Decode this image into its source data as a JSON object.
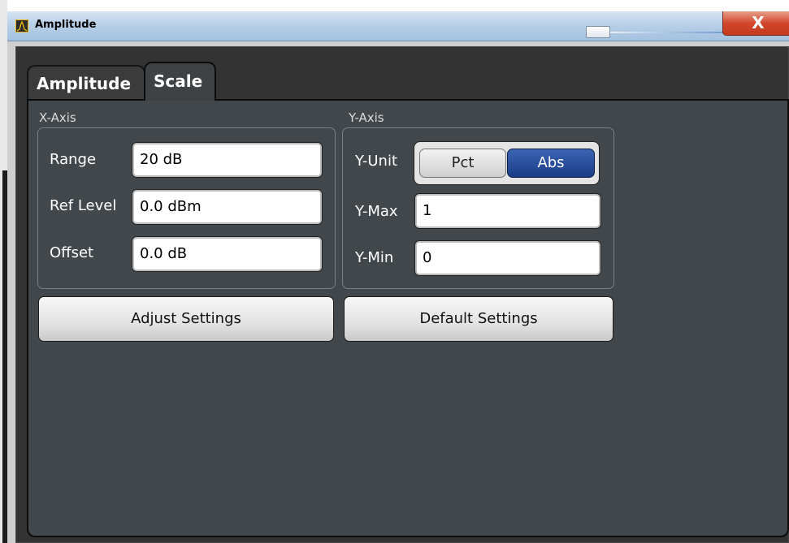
{
  "window": {
    "title": "Amplitude",
    "close_glyph": "X",
    "icon": "spectrum-icon"
  },
  "tabs": [
    {
      "label": "Amplitude",
      "active": false
    },
    {
      "label": "Scale",
      "active": true
    }
  ],
  "x_axis": {
    "title": "X-Axis",
    "range": {
      "label": "Range",
      "value": "20 dB"
    },
    "ref_level": {
      "label": "Ref Level",
      "value": "0.0 dBm"
    },
    "offset": {
      "label": "Offset",
      "value": "0.0 dB"
    }
  },
  "y_axis": {
    "title": "Y-Axis",
    "unit": {
      "label": "Y-Unit",
      "options": [
        "Pct",
        "Abs"
      ],
      "selected": "Abs"
    },
    "max": {
      "label": "Y-Max",
      "value": "1"
    },
    "min": {
      "label": "Y-Min",
      "value": "0"
    }
  },
  "buttons": {
    "adjust": "Adjust Settings",
    "default": "Default Settings"
  },
  "colors": {
    "selected_unit": "#1b3d86",
    "close_button": "#d2472b",
    "panel_bg": "#41474a"
  }
}
